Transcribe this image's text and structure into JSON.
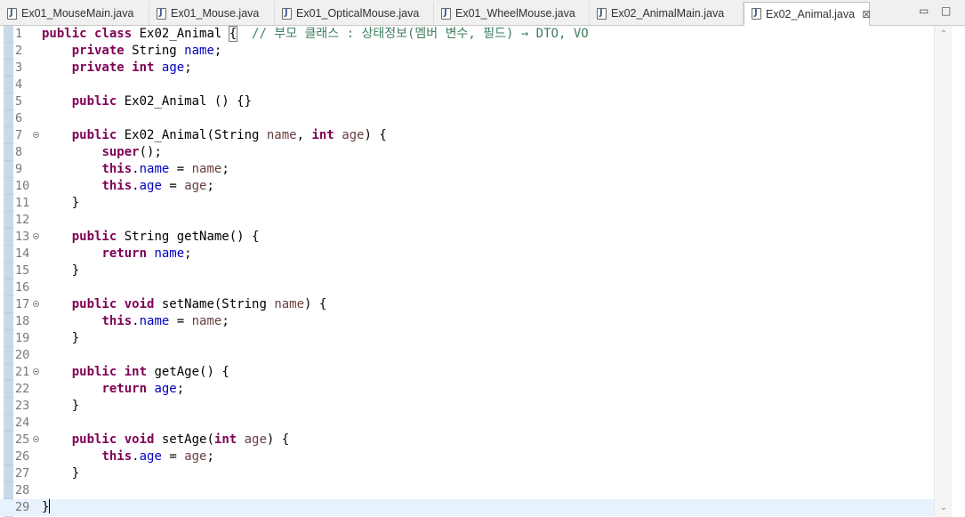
{
  "tabs": [
    {
      "label": "Ex01_MouseMain.java",
      "left": 0
    },
    {
      "label": "Ex01_Mouse.java"
    },
    {
      "label": "Ex01_OpticalMouse.java"
    },
    {
      "label": "Ex01_WheelMouse.java"
    },
    {
      "label": "Ex02_AnimalMain.java"
    },
    {
      "label": "Ex02_Animal.java",
      "active": true
    }
  ],
  "window_controls": {
    "minimize": "▭",
    "maximize": "□"
  },
  "tab_close_glyph": "⊠",
  "editor": {
    "file": "Ex02_Animal.java",
    "current_line": 29,
    "lines": [
      {
        "n": "1",
        "tokens": [
          [
            "kw",
            "public"
          ],
          [
            "t",
            " "
          ],
          [
            "kw",
            "class"
          ],
          [
            "t",
            " Ex02_Animal "
          ],
          [
            "hl",
            "{"
          ],
          [
            "t",
            "  "
          ],
          [
            "cmt",
            "// 부모 클래스 : 상태정보(멤버 변수, 필드) → DTO, VO"
          ]
        ]
      },
      {
        "n": "2",
        "tokens": [
          [
            "t",
            "    "
          ],
          [
            "kw",
            "private"
          ],
          [
            "t",
            " String "
          ],
          [
            "fld",
            "name"
          ],
          [
            "t",
            ";"
          ]
        ]
      },
      {
        "n": "3",
        "tokens": [
          [
            "t",
            "    "
          ],
          [
            "kw",
            "private"
          ],
          [
            "t",
            " "
          ],
          [
            "kw",
            "int"
          ],
          [
            "t",
            " "
          ],
          [
            "fld",
            "age"
          ],
          [
            "t",
            ";"
          ]
        ]
      },
      {
        "n": "4",
        "tokens": []
      },
      {
        "n": "5",
        "tokens": [
          [
            "t",
            "    "
          ],
          [
            "kw",
            "public"
          ],
          [
            "t",
            " Ex02_Animal () {}"
          ]
        ]
      },
      {
        "n": "6",
        "tokens": []
      },
      {
        "n": "7",
        "fold": true,
        "tokens": [
          [
            "t",
            "    "
          ],
          [
            "kw",
            "public"
          ],
          [
            "t",
            " Ex02_Animal(String "
          ],
          [
            "par",
            "name"
          ],
          [
            "t",
            ", "
          ],
          [
            "kw",
            "int"
          ],
          [
            "t",
            " "
          ],
          [
            "par",
            "age"
          ],
          [
            "t",
            ") {"
          ]
        ]
      },
      {
        "n": "8",
        "tokens": [
          [
            "t",
            "        "
          ],
          [
            "kw",
            "super"
          ],
          [
            "t",
            "();"
          ]
        ]
      },
      {
        "n": "9",
        "tokens": [
          [
            "t",
            "        "
          ],
          [
            "kw",
            "this"
          ],
          [
            "t",
            "."
          ],
          [
            "fld",
            "name"
          ],
          [
            "t",
            " = "
          ],
          [
            "par",
            "name"
          ],
          [
            "t",
            ";"
          ]
        ]
      },
      {
        "n": "10",
        "tokens": [
          [
            "t",
            "        "
          ],
          [
            "kw",
            "this"
          ],
          [
            "t",
            "."
          ],
          [
            "fld",
            "age"
          ],
          [
            "t",
            " = "
          ],
          [
            "par",
            "age"
          ],
          [
            "t",
            ";"
          ]
        ]
      },
      {
        "n": "11",
        "tokens": [
          [
            "t",
            "    }"
          ]
        ]
      },
      {
        "n": "12",
        "tokens": []
      },
      {
        "n": "13",
        "fold": true,
        "tokens": [
          [
            "t",
            "    "
          ],
          [
            "kw",
            "public"
          ],
          [
            "t",
            " String getName() {"
          ]
        ]
      },
      {
        "n": "14",
        "tokens": [
          [
            "t",
            "        "
          ],
          [
            "kw",
            "return"
          ],
          [
            "t",
            " "
          ],
          [
            "fld",
            "name"
          ],
          [
            "t",
            ";"
          ]
        ]
      },
      {
        "n": "15",
        "tokens": [
          [
            "t",
            "    }"
          ]
        ]
      },
      {
        "n": "16",
        "tokens": []
      },
      {
        "n": "17",
        "fold": true,
        "tokens": [
          [
            "t",
            "    "
          ],
          [
            "kw",
            "public"
          ],
          [
            "t",
            " "
          ],
          [
            "kw",
            "void"
          ],
          [
            "t",
            " setName(String "
          ],
          [
            "par",
            "name"
          ],
          [
            "t",
            ") {"
          ]
        ]
      },
      {
        "n": "18",
        "tokens": [
          [
            "t",
            "        "
          ],
          [
            "kw",
            "this"
          ],
          [
            "t",
            "."
          ],
          [
            "fld",
            "name"
          ],
          [
            "t",
            " = "
          ],
          [
            "par",
            "name"
          ],
          [
            "t",
            ";"
          ]
        ]
      },
      {
        "n": "19",
        "tokens": [
          [
            "t",
            "    }"
          ]
        ]
      },
      {
        "n": "20",
        "tokens": []
      },
      {
        "n": "21",
        "fold": true,
        "tokens": [
          [
            "t",
            "    "
          ],
          [
            "kw",
            "public"
          ],
          [
            "t",
            " "
          ],
          [
            "kw",
            "int"
          ],
          [
            "t",
            " getAge() {"
          ]
        ]
      },
      {
        "n": "22",
        "tokens": [
          [
            "t",
            "        "
          ],
          [
            "kw",
            "return"
          ],
          [
            "t",
            " "
          ],
          [
            "fld",
            "age"
          ],
          [
            "t",
            ";"
          ]
        ]
      },
      {
        "n": "23",
        "tokens": [
          [
            "t",
            "    }"
          ]
        ]
      },
      {
        "n": "24",
        "tokens": []
      },
      {
        "n": "25",
        "fold": true,
        "tokens": [
          [
            "t",
            "    "
          ],
          [
            "kw",
            "public"
          ],
          [
            "t",
            " "
          ],
          [
            "kw",
            "void"
          ],
          [
            "t",
            " setAge("
          ],
          [
            "kw",
            "int"
          ],
          [
            "t",
            " "
          ],
          [
            "par",
            "age"
          ],
          [
            "t",
            ") {"
          ]
        ]
      },
      {
        "n": "26",
        "tokens": [
          [
            "t",
            "        "
          ],
          [
            "kw",
            "this"
          ],
          [
            "t",
            "."
          ],
          [
            "fld",
            "age"
          ],
          [
            "t",
            " = "
          ],
          [
            "par",
            "age"
          ],
          [
            "t",
            ";"
          ]
        ]
      },
      {
        "n": "27",
        "tokens": [
          [
            "t",
            "    }"
          ]
        ]
      },
      {
        "n": "28",
        "tokens": []
      },
      {
        "n": "29",
        "caret": true,
        "tokens": [
          [
            "t",
            "}"
          ]
        ]
      }
    ]
  },
  "scrollbar": {
    "up": "⌃",
    "down": "⌄"
  }
}
